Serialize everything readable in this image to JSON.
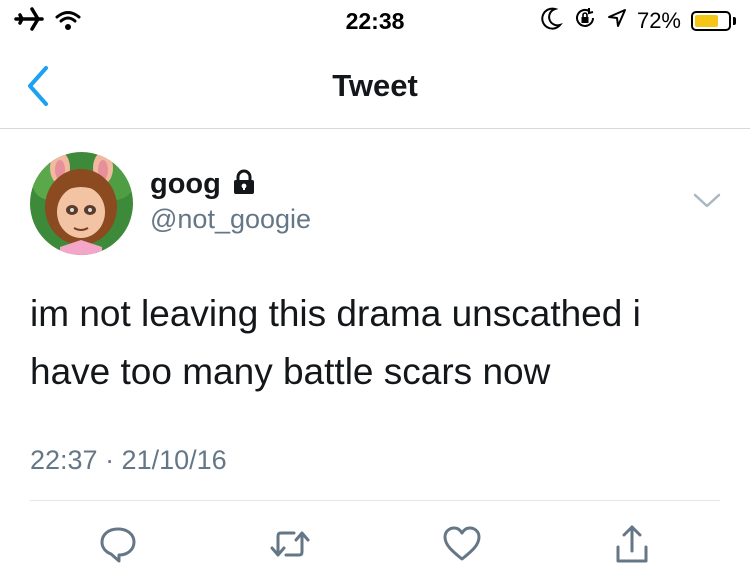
{
  "status_bar": {
    "time": "22:38",
    "battery_percent": "72%",
    "battery_level": 0.72,
    "battery_color": "#f5c518",
    "icons": [
      "airplane-icon",
      "wifi-icon",
      "moon-icon",
      "rotation-lock-icon",
      "location-arrow-icon",
      "battery-icon"
    ]
  },
  "nav": {
    "title": "Tweet",
    "back_icon": "chevron-left-icon",
    "accent": "#1da1f2"
  },
  "tweet": {
    "display_name": "goog",
    "protected_icon": "lock-icon",
    "handle": "@not_googie",
    "text": "im not leaving this drama unscathed i have too many battle scars now",
    "timestamp": "22:37 · 21/10/16"
  },
  "actions": [
    {
      "name": "reply",
      "icon": "reply-icon"
    },
    {
      "name": "retweet",
      "icon": "retweet-icon"
    },
    {
      "name": "like",
      "icon": "heart-icon"
    },
    {
      "name": "share",
      "icon": "share-icon"
    }
  ]
}
